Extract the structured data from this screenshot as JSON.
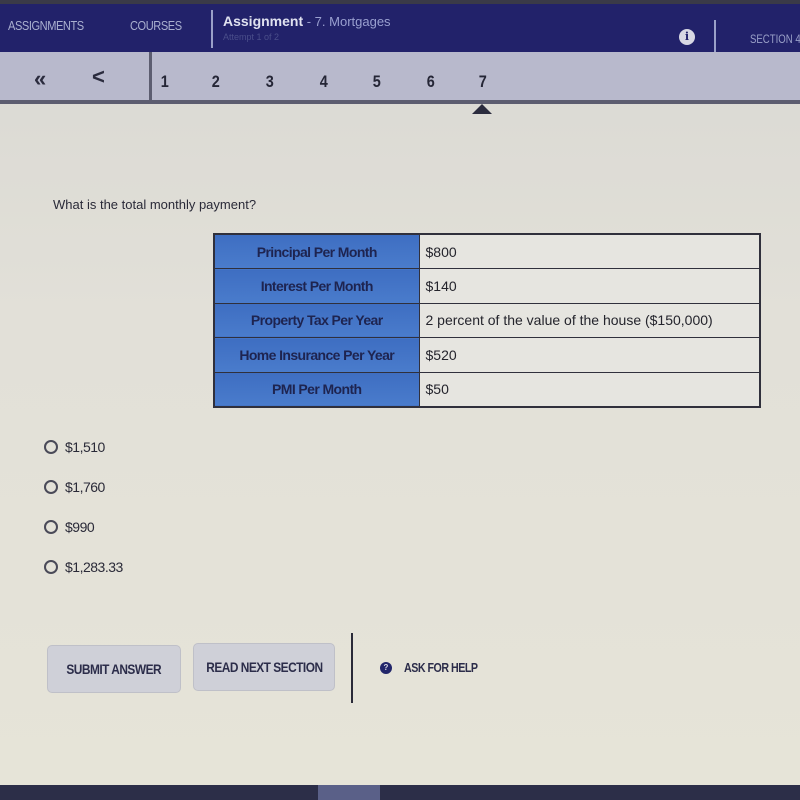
{
  "topbar": {
    "nav_assignments": "ASSIGNMENTS",
    "nav_courses": "COURSES",
    "assignment_label": "Assignment",
    "assignment_name": " - 7. Mortgages",
    "attempt": "Attempt 1 of 2",
    "info_icon": "i",
    "section_label": "SECTION 4"
  },
  "pager": {
    "first_label": "«",
    "prev_label": "<",
    "pages": [
      "1",
      "2",
      "3",
      "4",
      "5",
      "6",
      "7"
    ],
    "active_page": "7"
  },
  "question": {
    "text": "What is the total monthly payment?"
  },
  "table": {
    "rows": [
      {
        "label": "Principal Per Month",
        "value": "$800"
      },
      {
        "label": "Interest Per Month",
        "value": "$140"
      },
      {
        "label": "Property Tax Per Year",
        "value": "2 percent of the value of the house ($150,000)"
      },
      {
        "label": "Home Insurance Per Year",
        "value": "$520"
      },
      {
        "label": "PMI Per Month",
        "value": "$50"
      }
    ]
  },
  "options": [
    {
      "label": "$1,510",
      "selected": false
    },
    {
      "label": "$1,760",
      "selected": false
    },
    {
      "label": "$990",
      "selected": false
    },
    {
      "label": "$1,283.33",
      "selected": false
    }
  ],
  "actions": {
    "submit": "SUBMIT ANSWER",
    "read_next": "READ NEXT SECTION",
    "help": "ASK FOR HELP",
    "help_icon": "?"
  },
  "colors": {
    "topbar": "#22226a",
    "pager": "#b8b9cc",
    "table_label": "#3e6ec2"
  }
}
